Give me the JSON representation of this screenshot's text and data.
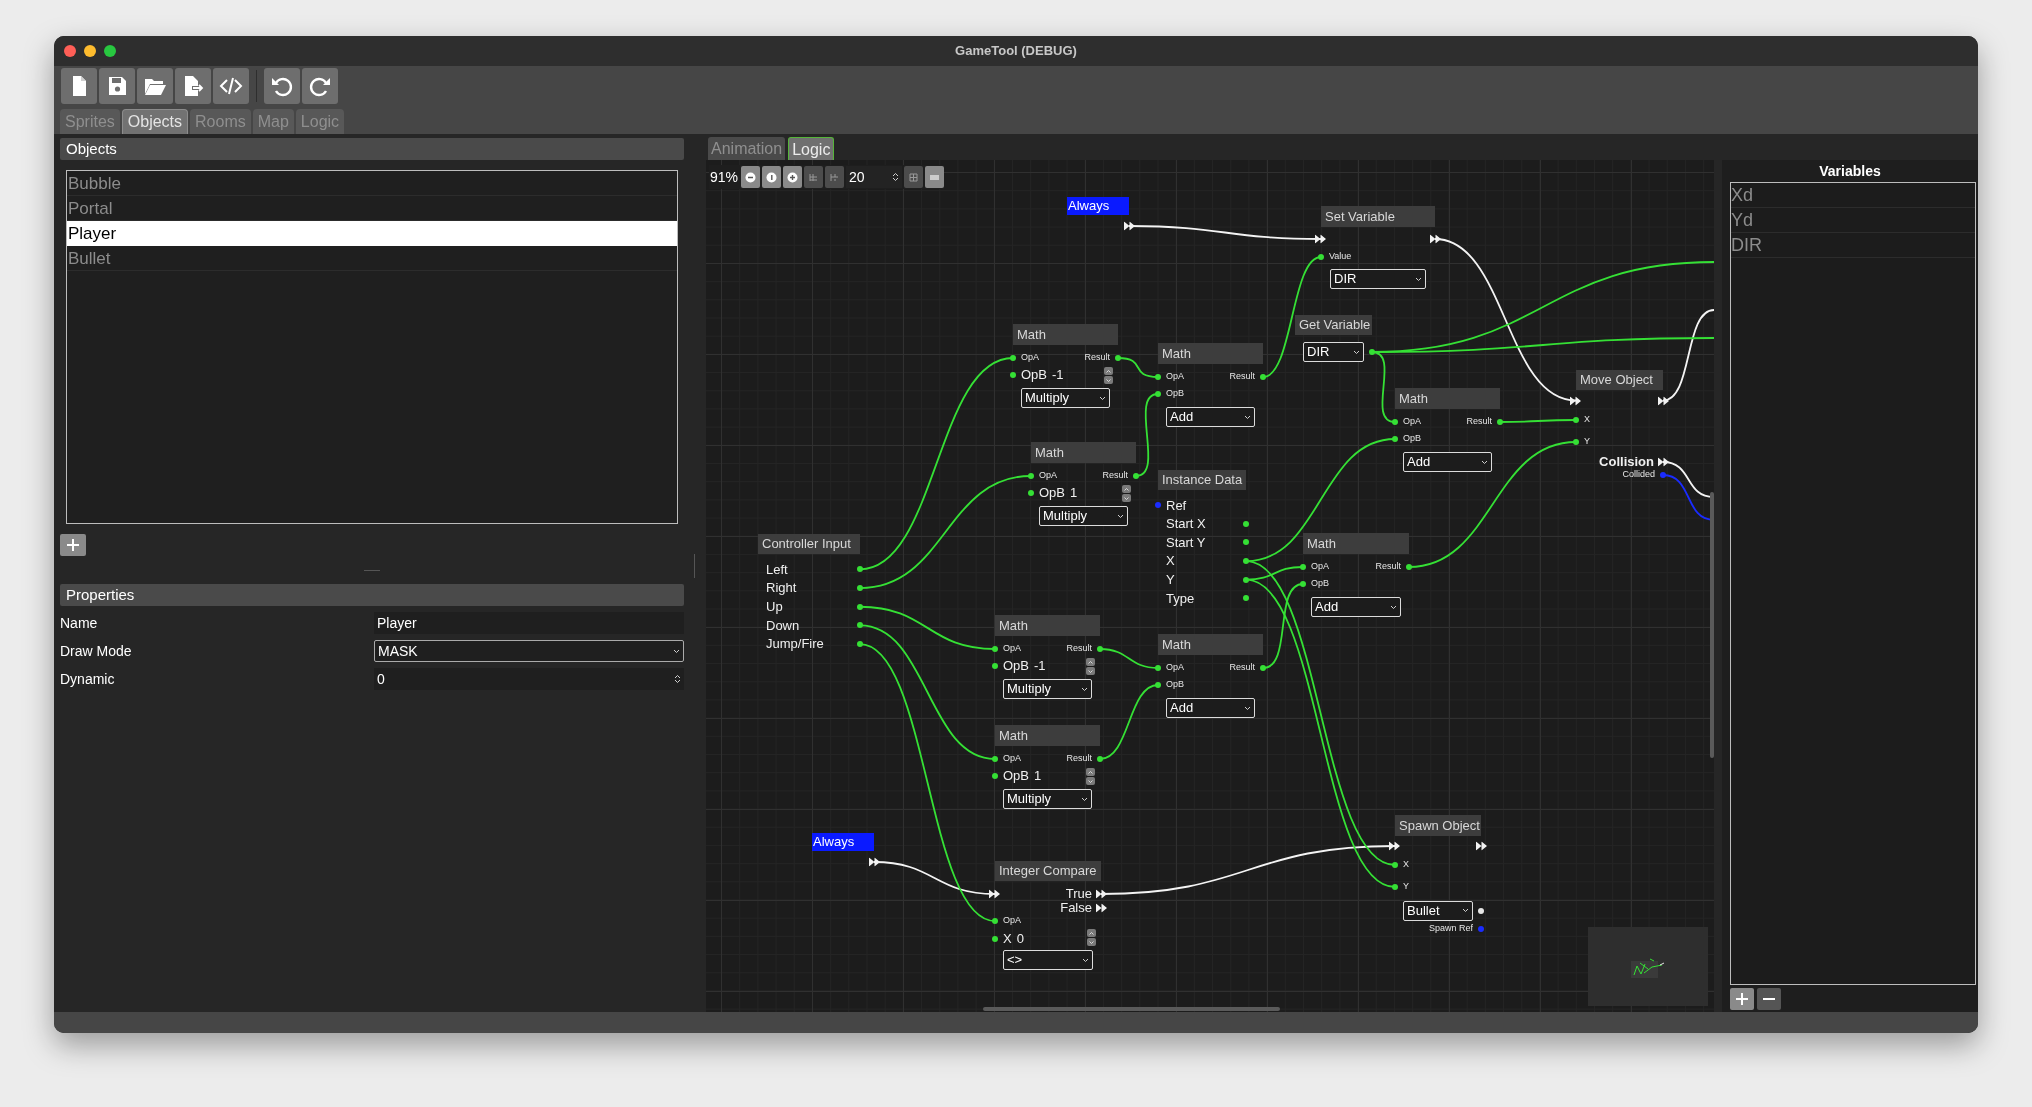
{
  "window": {
    "title": "GameTool (DEBUG)"
  },
  "main_tabs": [
    {
      "label": "Sprites",
      "selected": false
    },
    {
      "label": "Objects",
      "selected": true
    },
    {
      "label": "Rooms",
      "selected": false
    },
    {
      "label": "Map",
      "selected": false
    },
    {
      "label": "Logic",
      "selected": false
    }
  ],
  "objects_panel": {
    "title": "Objects",
    "items": [
      {
        "label": "Bubble",
        "selected": false
      },
      {
        "label": "Portal",
        "selected": false
      },
      {
        "label": "Player",
        "selected": true
      },
      {
        "label": "Bullet",
        "selected": false
      }
    ]
  },
  "properties": {
    "title": "Properties",
    "rows": [
      {
        "label": "Name",
        "kind": "text",
        "value": "Player"
      },
      {
        "label": "Draw Mode",
        "kind": "select",
        "value": "MASK"
      },
      {
        "label": "Dynamic",
        "kind": "spin",
        "value": "0"
      }
    ]
  },
  "editor_tabs": [
    {
      "label": "Animation",
      "selected": false
    },
    {
      "label": "Logic",
      "selected": true
    }
  ],
  "graph_toolbar": {
    "zoom": "91%",
    "grid_size": "20"
  },
  "nodes": [
    {
      "kind": "event",
      "title": "Always"
    },
    {
      "kind": "set_variable",
      "title": "Set Variable",
      "value_label": "Value",
      "variable": "DIR"
    },
    {
      "kind": "math",
      "title": "Math",
      "a_label": "OpA",
      "result_label": "Result",
      "b_label": "OpB",
      "b_value": "-1",
      "operation": "Multiply"
    },
    {
      "kind": "get_variable",
      "title": "Get Variable",
      "variable": "DIR"
    },
    {
      "kind": "math",
      "title": "Math",
      "a_label": "OpA",
      "result_label": "Result",
      "b_label": "OpB",
      "operation": "Add"
    },
    {
      "kind": "math",
      "title": "Math",
      "a_label": "OpA",
      "result_label": "Result",
      "b_label": "OpB",
      "operation": "Add"
    },
    {
      "kind": "move_object",
      "title": "Move Object",
      "inputs": [
        "X",
        "Y"
      ],
      "event_output": "Collision",
      "value_output": "Collided"
    },
    {
      "kind": "math",
      "title": "Math",
      "a_label": "OpA",
      "result_label": "Result",
      "b_label": "OpB",
      "b_value": "1",
      "operation": "Multiply"
    },
    {
      "kind": "instance_data",
      "title": "Instance Data",
      "fields": [
        {
          "label": "Ref",
          "kind": "reference"
        },
        {
          "label": "Start X",
          "kind": "value"
        },
        {
          "label": "Start Y",
          "kind": "value"
        },
        {
          "label": "X",
          "kind": "value"
        },
        {
          "label": "Y",
          "kind": "value"
        },
        {
          "label": "Type",
          "kind": "value"
        }
      ]
    },
    {
      "kind": "controller_input",
      "title": "Controller Input",
      "outputs": [
        "Left",
        "Right",
        "Up",
        "Down",
        "Jump/Fire"
      ]
    },
    {
      "kind": "math",
      "title": "Math",
      "a_label": "OpA",
      "result_label": "Result",
      "b_label": "OpB",
      "operation": "Add"
    },
    {
      "kind": "math",
      "title": "Math",
      "a_label": "OpA",
      "result_label": "Result",
      "b_label": "OpB",
      "b_value": "-1",
      "operation": "Multiply"
    },
    {
      "kind": "math",
      "title": "Math",
      "a_label": "OpA",
      "result_label": "Result",
      "b_label": "OpB",
      "operation": "Add"
    },
    {
      "kind": "math",
      "title": "Math",
      "a_label": "OpA",
      "result_label": "Result",
      "b_label": "OpB",
      "b_value": "1",
      "operation": "Multiply"
    },
    {
      "kind": "spawn_object",
      "title": "Spawn Object",
      "inputs": [
        "X",
        "Y"
      ],
      "object": "Bullet",
      "output": "Spawn Ref"
    },
    {
      "kind": "event",
      "title": "Always"
    },
    {
      "kind": "integer_compare",
      "title": "Integer Compare",
      "true_label": "True",
      "false_label": "False",
      "a_label": "OpA",
      "b_label": "X",
      "b_value": "0",
      "operation": "<>"
    }
  ],
  "variables": {
    "title": "Variables",
    "items": [
      "Xd",
      "Yd",
      "DIR"
    ]
  }
}
